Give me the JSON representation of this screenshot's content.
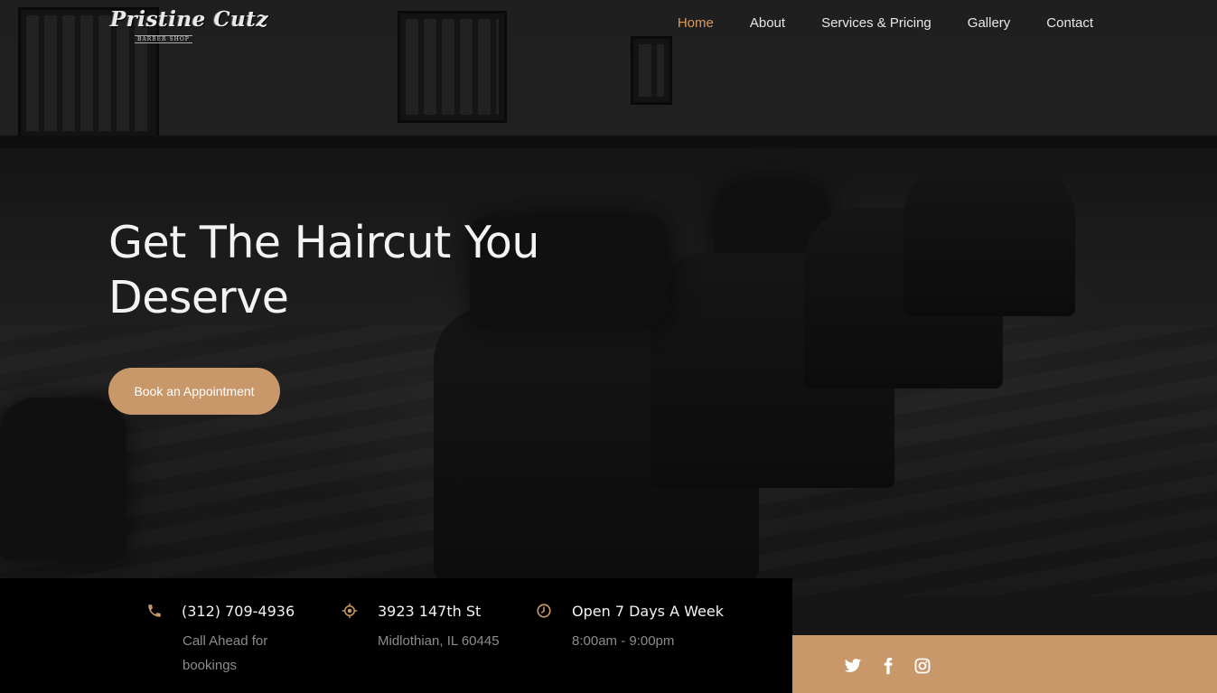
{
  "brand": {
    "logo_script": "Pristine Cutz",
    "logo_sub": "BARBER SHOP"
  },
  "nav": {
    "items": [
      {
        "label": "Home",
        "active": true
      },
      {
        "label": "About",
        "active": false
      },
      {
        "label": "Services & Pricing",
        "active": false
      },
      {
        "label": "Gallery",
        "active": false
      },
      {
        "label": "Contact",
        "active": false
      }
    ]
  },
  "hero": {
    "title_line1": "Get The Haircut You",
    "title_line2": "Deserve",
    "cta_label": "Book an Appointment"
  },
  "info": {
    "phone": {
      "icon": "phone-icon",
      "title": "(312) 709-4936",
      "sub_line1": "Call Ahead for",
      "sub_line2": "bookings"
    },
    "location": {
      "icon": "location-target-icon",
      "title": "3923 147th St",
      "sub_line1": "Midlothian, IL 60445"
    },
    "hours": {
      "icon": "clock-icon",
      "title": "Open 7 Days A Week",
      "sub_line1": "8:00am - 9:00pm"
    }
  },
  "social": {
    "items": [
      "twitter-icon",
      "facebook-icon",
      "instagram-icon"
    ]
  },
  "colors": {
    "accent": "#c8976a",
    "nav_active": "#d99a5e",
    "info_bar_bg": "#000000",
    "social_bar_bg": "#c8976a"
  }
}
